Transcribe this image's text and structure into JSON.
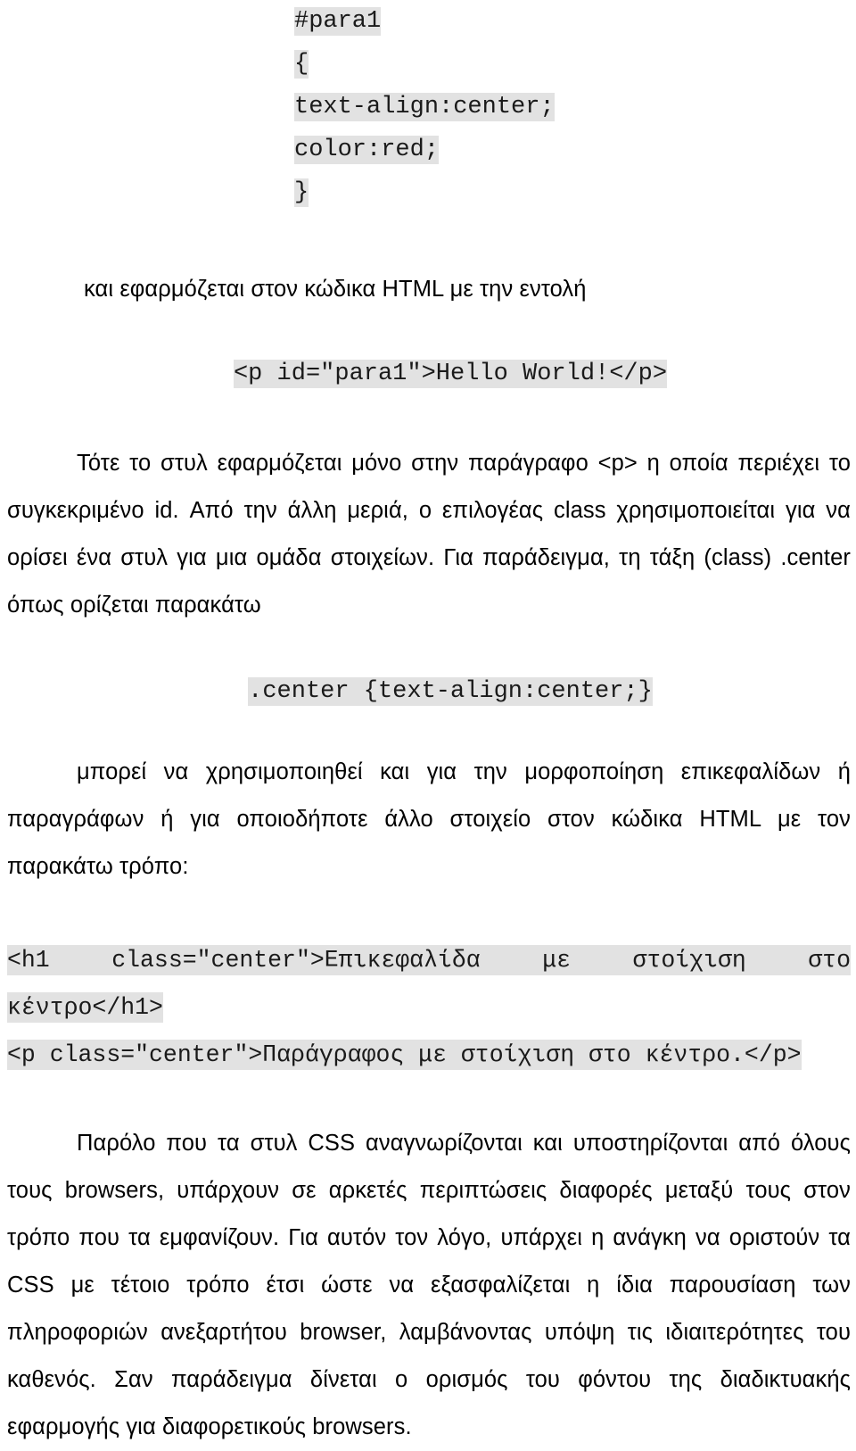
{
  "document": {
    "language": "el",
    "background_color": "#ffffff",
    "text_color": "#000000",
    "code_highlight_color": "#e2e2e2"
  },
  "css_rule_block": {
    "lines": [
      "#para1",
      "{",
      "text-align:center;",
      "color:red;",
      "}"
    ]
  },
  "intro_line": "και εφαρμόζεται στον κώδικα HTML με την εντολή",
  "html_example_1": "<p id=\"para1\">Hello World!</p>",
  "paragraph_1": "Τότε το στυλ εφαρμόζεται μόνο στην παράγραφο <p> η οποία περιέχει το συγκεκριμένο id. Από την άλλη μεριά, ο επιλογέας class χρησιμοποιείται για να ορίσει ένα στυλ για μια ομάδα στοιχείων. Για παράδειγμα, τη τάξη (class) .center όπως ορίζεται παρακάτω",
  "css_rule_inline": ".center {text-align:center;}",
  "paragraph_2": "μπορεί να χρησιμοποιηθεί και για την μορφοποίηση επικεφαλίδων ή παραγράφων ή για οποιοδήποτε άλλο στοιχείο στον κώδικα HTML με τον παρακάτω τρόπο:",
  "html_example_2": {
    "line_1": "<h1 class=\"center\">Επικεφαλίδα με στοίχιση στο",
    "line_2": "κέντρο</h1>",
    "line_3": "<p class=\"center\">Παράγραφος με στοίχιση στο κέντρο.</p>"
  },
  "paragraph_3": "Παρόλο που τα στυλ CSS αναγνωρίζονται και υποστηρίζονται από όλους τους browsers, υπάρχουν σε αρκετές περιπτώσεις διαφορές μεταξύ τους στον τρόπο που τα εμφανίζουν. Για αυτόν τον λόγο, υπάρχει η ανάγκη να οριστούν τα CSS με τέτοιο τρόπο έτσι ώστε να εξασφαλίζεται η ίδια παρουσίαση των πληροφοριών ανεξαρτήτου browser, λαμβάνοντας υπόψη τις ιδιαιτερότητες του καθενός. Σαν παράδειγμα δίνεται ο ορισμός του φόντου της διαδικτυακής εφαρμογής για διαφορετικούς browsers."
}
